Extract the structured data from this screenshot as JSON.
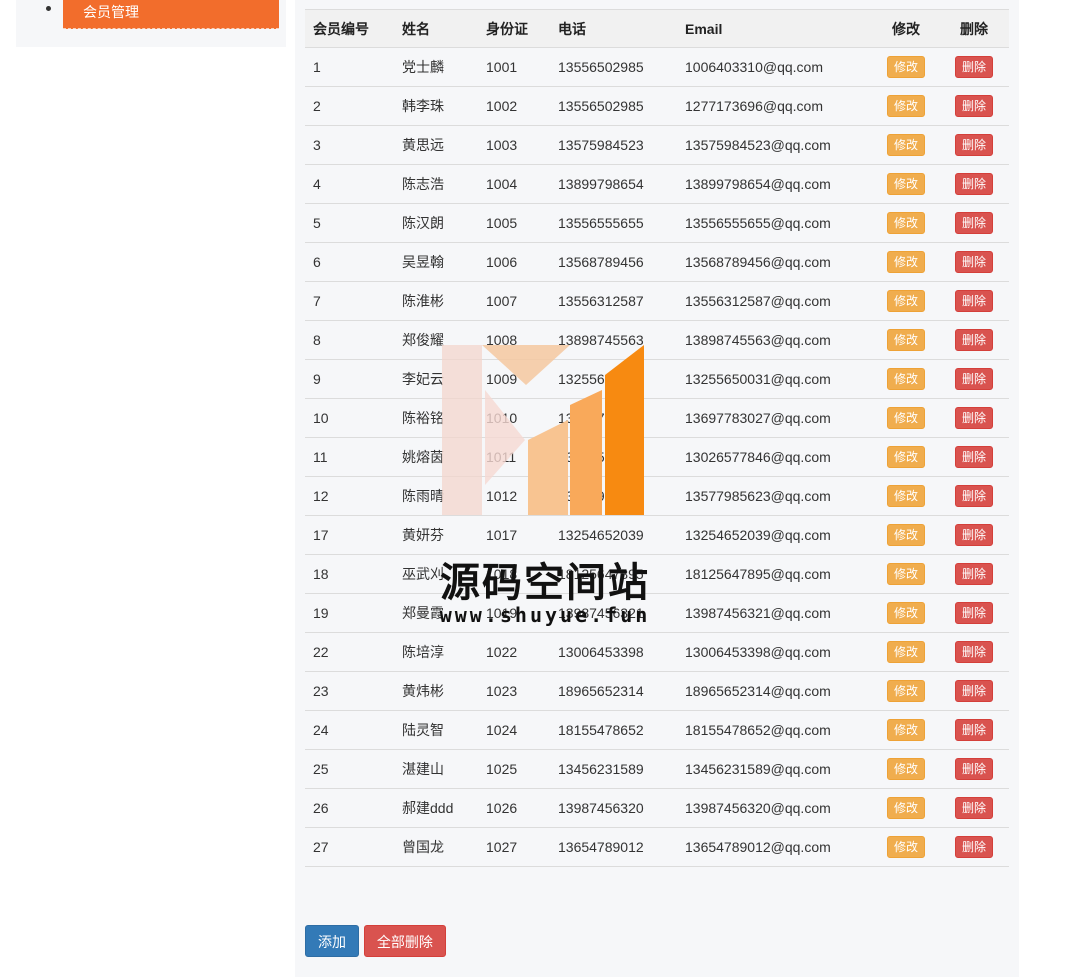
{
  "sidebar": {
    "items": [
      {
        "label": "会员管理"
      }
    ]
  },
  "table": {
    "headers": [
      "会员编号",
      "姓名",
      "身份证",
      "电话",
      "Email",
      "修改",
      "删除"
    ],
    "edit_label": "修改",
    "delete_label": "删除",
    "rows": [
      [
        "1",
        "党士麟",
        "1001",
        "13556502985",
        "1006403310@qq.com"
      ],
      [
        "2",
        "韩李珠",
        "1002",
        "13556502985",
        "1277173696@qq.com"
      ],
      [
        "3",
        "黄思远",
        "1003",
        "13575984523",
        "13575984523@qq.com"
      ],
      [
        "4",
        "陈志浩",
        "1004",
        "13899798654",
        "13899798654@qq.com"
      ],
      [
        "5",
        "陈汉朗",
        "1005",
        "13556555655",
        "13556555655@qq.com"
      ],
      [
        "6",
        "吴昱翰",
        "1006",
        "13568789456",
        "13568789456@qq.com"
      ],
      [
        "7",
        "陈淮彬",
        "1007",
        "13556312587",
        "13556312587@qq.com"
      ],
      [
        "8",
        "郑俊耀",
        "1008",
        "13898745563",
        "13898745563@qq.com"
      ],
      [
        "9",
        "李妃云",
        "1009",
        "13255650031",
        "13255650031@qq.com"
      ],
      [
        "10",
        "陈裕铭",
        "1010",
        "13697783027",
        "13697783027@qq.com"
      ],
      [
        "11",
        "姚熔茵",
        "1011",
        "13026577846",
        "13026577846@qq.com"
      ],
      [
        "12",
        "陈雨晴",
        "1012",
        "13577985623",
        "13577985623@qq.com"
      ],
      [
        "17",
        "黄妍芬",
        "1017",
        "13254652039",
        "13254652039@qq.com"
      ],
      [
        "18",
        "巫武刈",
        "1018",
        "18125647895",
        "18125647895@qq.com"
      ],
      [
        "19",
        "郑曼霞",
        "1019",
        "13987456321",
        "13987456321@qq.com"
      ],
      [
        "22",
        "陈培淳",
        "1022",
        "13006453398",
        "13006453398@qq.com"
      ],
      [
        "23",
        "黄炜彬",
        "1023",
        "18965652314",
        "18965652314@qq.com"
      ],
      [
        "24",
        "陆灵智",
        "1024",
        "18155478652",
        "18155478652@qq.com"
      ],
      [
        "25",
        "湛建山",
        "1025",
        "13456231589",
        "13456231589@qq.com"
      ],
      [
        "26",
        "郝建ddd",
        "1026",
        "13987456320",
        "13987456320@qq.com"
      ],
      [
        "27",
        "曾国龙",
        "1027",
        "13654789012",
        "13654789012@qq.com"
      ]
    ]
  },
  "actions": {
    "add_label": "添加",
    "delete_all_label": "全部删除"
  },
  "watermark": {
    "title": "源码空间站",
    "url": "www.shuyue.fun"
  },
  "colors": {
    "nav_active": "#f26d2c",
    "edit_button": "#f0ad4e",
    "delete_button": "#d9534f",
    "add_button": "#337ab7"
  }
}
